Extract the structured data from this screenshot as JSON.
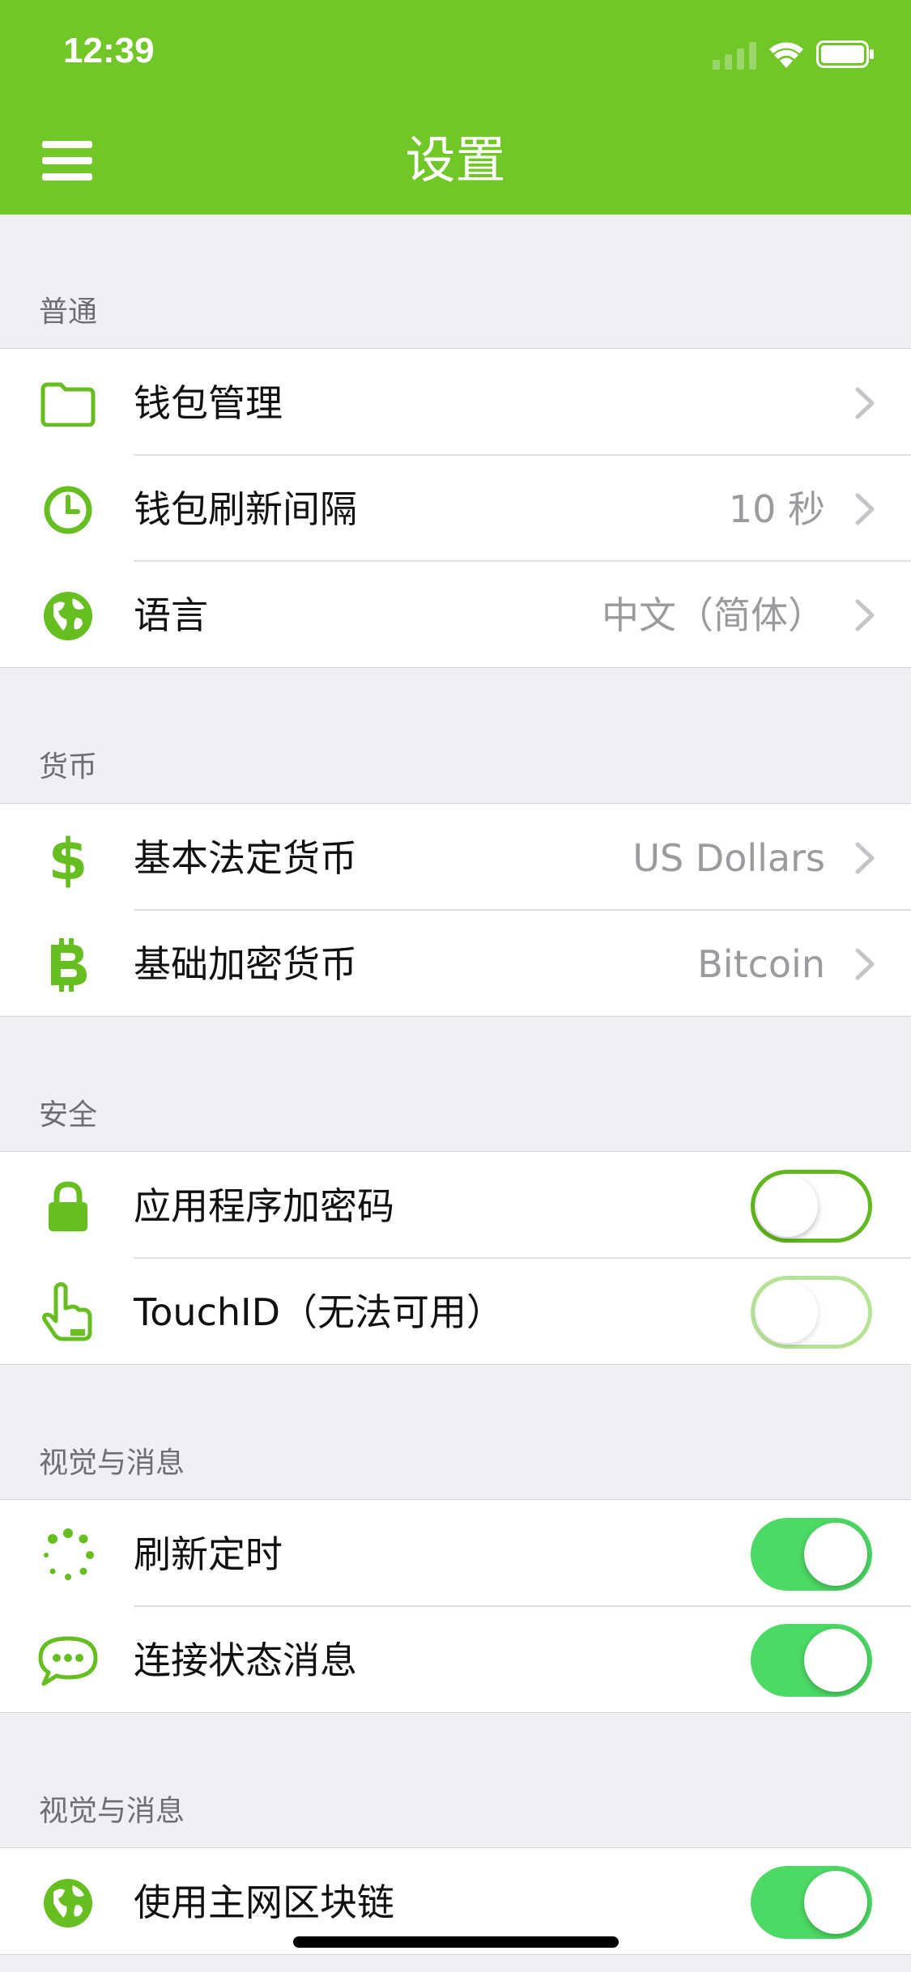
{
  "status_bar": {
    "time": "12:39"
  },
  "nav": {
    "title": "设置",
    "menu_icon": "hamburger-menu-icon"
  },
  "colors": {
    "brand": "#71c628",
    "toggle_on": "#4cd964",
    "toggle_off_border": "#60b91e"
  },
  "sections": [
    {
      "header": "普通",
      "rows": [
        {
          "icon": "folder-icon",
          "label": "钱包管理",
          "value": ""
        },
        {
          "icon": "clock-icon",
          "label": "钱包刷新间隔",
          "value": "10 秒"
        },
        {
          "icon": "globe-icon",
          "label": "语言",
          "value": "中文（简体）"
        }
      ]
    },
    {
      "header": "货币",
      "rows": [
        {
          "icon": "dollar-icon",
          "label": "基本法定货币",
          "value": "US Dollars"
        },
        {
          "icon": "bitcoin-icon",
          "label": "基础加密货币",
          "value": "Bitcoin"
        }
      ]
    },
    {
      "header": "安全",
      "rows": [
        {
          "icon": "lock-icon",
          "label": "应用程序加密码",
          "toggle": false
        },
        {
          "icon": "touch-hand-icon",
          "label": "TouchID（无法可用）",
          "toggle": false,
          "disabled": true
        }
      ]
    },
    {
      "header": "视觉与消息",
      "rows": [
        {
          "icon": "spinner-icon",
          "label": "刷新定时",
          "toggle": true
        },
        {
          "icon": "chat-bubble-icon",
          "label": "连接状态消息",
          "toggle": true
        }
      ]
    },
    {
      "header": "视觉与消息",
      "rows": [
        {
          "icon": "globe-icon",
          "label": "使用主网区块链",
          "toggle": true
        }
      ]
    }
  ]
}
